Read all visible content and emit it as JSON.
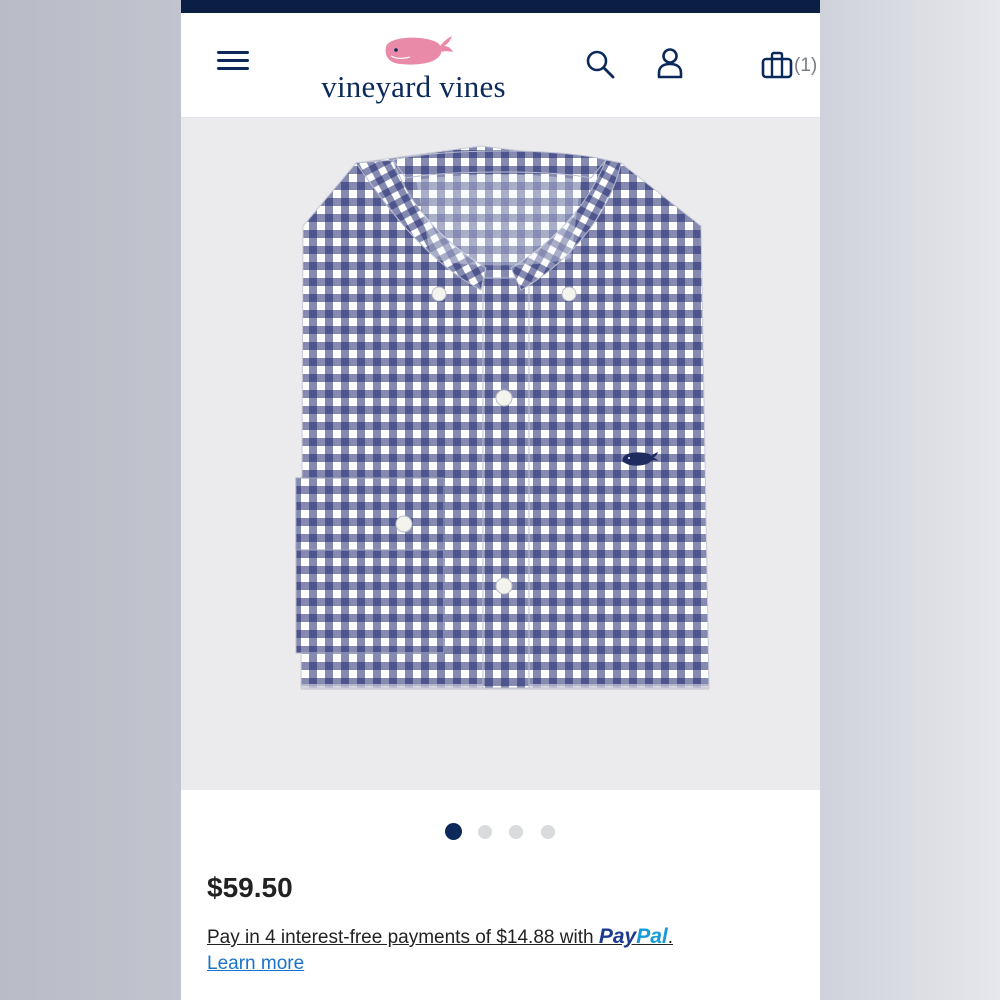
{
  "header": {
    "brand_name": "vineyard vines",
    "cart_count": "(1)"
  },
  "carousel": {
    "total": 4,
    "active_index": 0
  },
  "product": {
    "price": "$59.50",
    "paypal_text": "Pay in 4 interest-free payments of $14.88 with ",
    "paypal_brand_pay": "Pay",
    "paypal_brand_pal": "Pal",
    "paypal_suffix": ".",
    "learn_more": "Learn more"
  },
  "colors": {
    "navy": "#0b2a5b",
    "gingham_blue": "#1f2a6e",
    "whale_pink": "#e88aa8",
    "link_blue": "#1a73c8"
  },
  "icons": [
    "menu-icon",
    "whale-logo-icon",
    "search-icon",
    "account-icon",
    "shopping-bag-icon"
  ]
}
